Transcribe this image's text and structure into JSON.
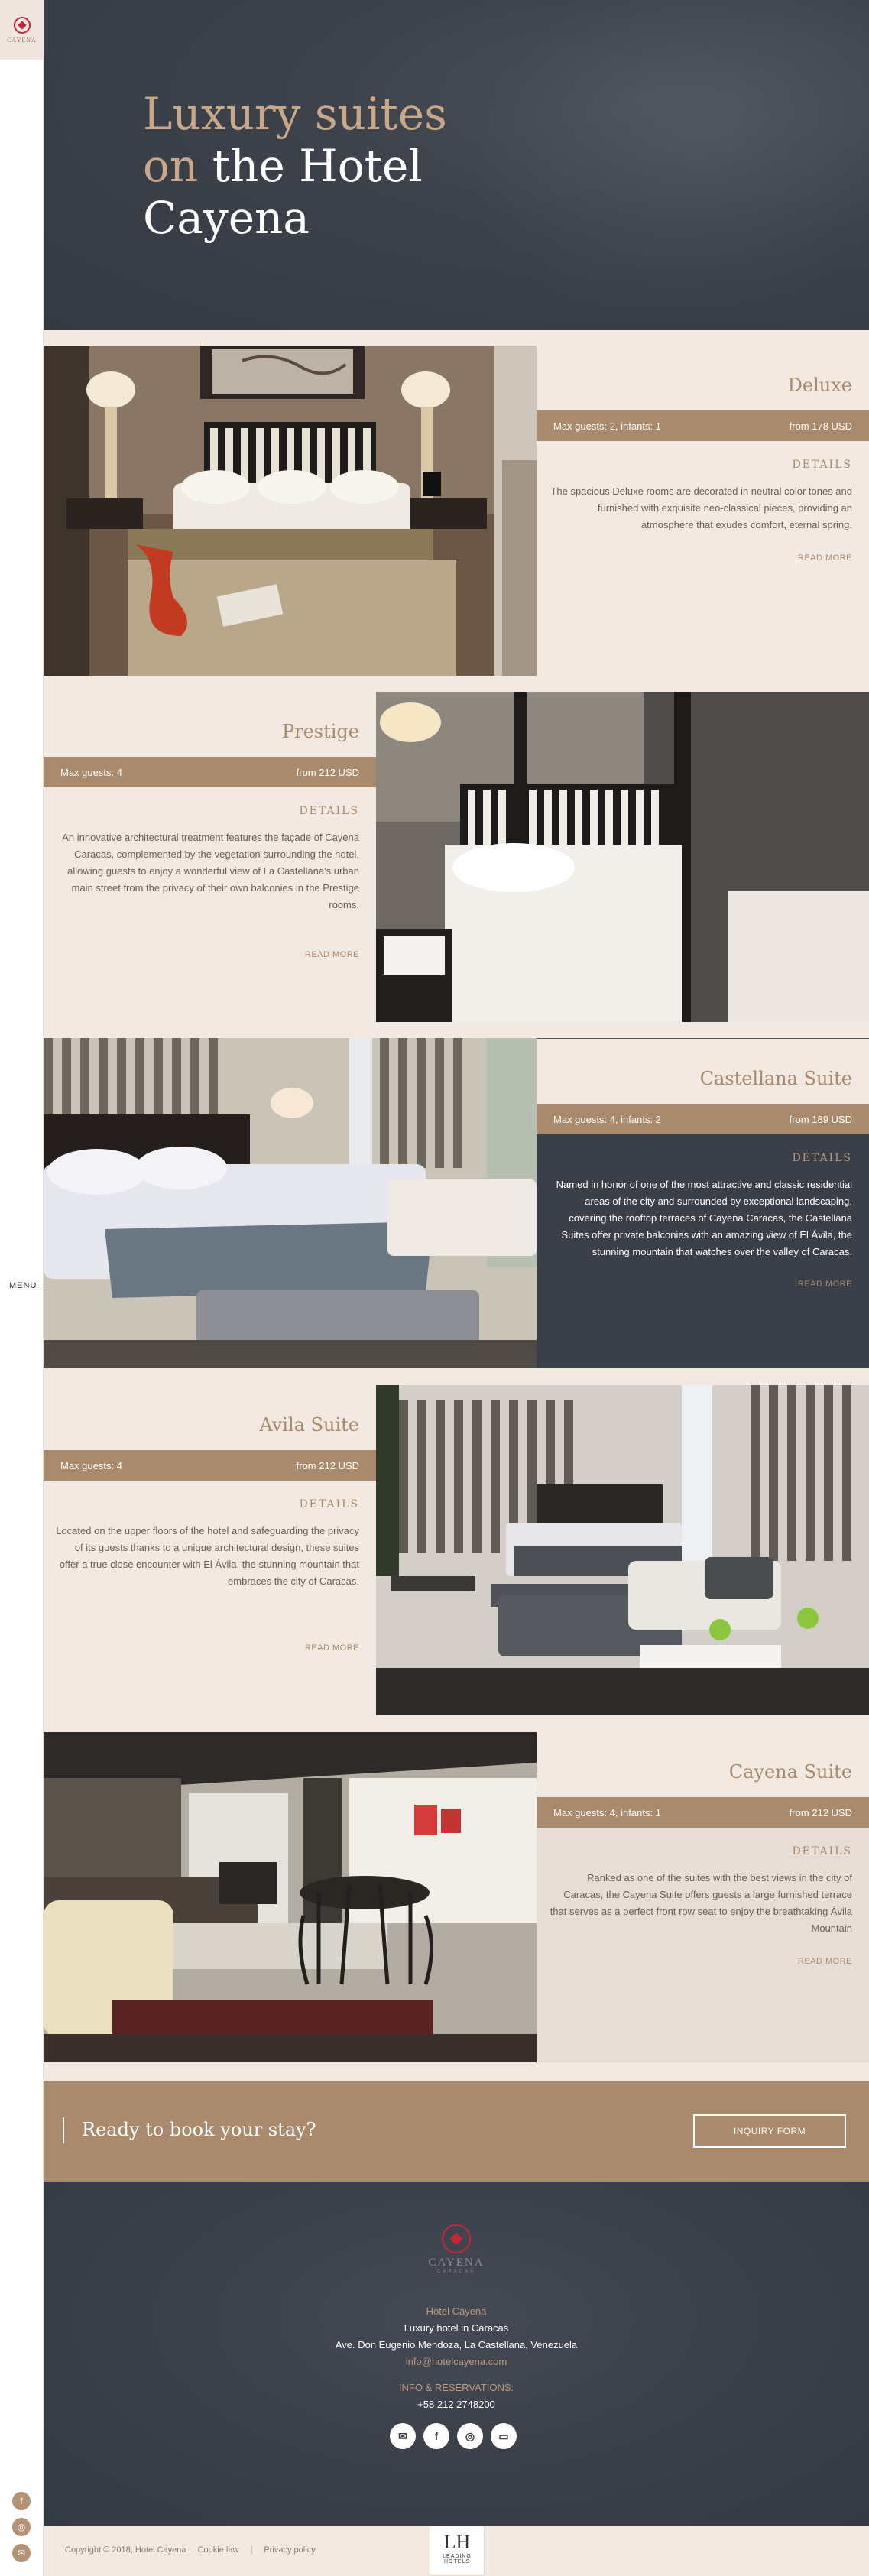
{
  "brand": {
    "rail_logo_text": "CAYENA",
    "footer_logo_name": "CAYENA",
    "footer_logo_sub": "CARACAS"
  },
  "rail": {
    "menu_label": "MENU",
    "social": [
      "f",
      "◎",
      "✉"
    ]
  },
  "hero": {
    "line1": "Luxury suites",
    "line2_accent": "on",
    "line2_rest": "the Hotel",
    "line3": "Cayena"
  },
  "suites": [
    {
      "title": "Deluxe",
      "guests": "Max guests: 2, infants: 1",
      "price": "from 178 USD",
      "details_label": "DETAILS",
      "description": "The spacious Deluxe rooms are decorated in neutral color tones and furnished with exquisite neo-classical pieces, providing an atmosphere that exudes comfort, eternal spring.",
      "more": "READ MORE"
    },
    {
      "title": "Prestige",
      "guests": "Max guests: 4",
      "price": "from 212 USD",
      "details_label": "DETAILS",
      "description": "An innovative architectural treatment features the façade of Cayena Caracas, complemented by the vegetation surrounding the hotel, allowing guests to enjoy a wonderful view of La Castellana's urban main street from the privacy of their own balconies in the Prestige rooms.",
      "more": "READ MORE"
    },
    {
      "title": "Castellana Suite",
      "guests": "Max guests: 4, infants: 2",
      "price": "from 189 USD",
      "details_label": "DETAILS",
      "description": "Named in honor of one of the most attractive and classic residential areas of the city and surrounded by exceptional landscaping, covering the rooftop terraces of Cayena Caracas, the Castellana Suites offer private balconies with an amazing view of El Ávila, the stunning mountain that watches over the valley of Caracas.",
      "more": "READ MORE"
    },
    {
      "title": "Avila Suite",
      "guests": "Max guests: 4",
      "price": "from 212 USD",
      "details_label": "DETAILS",
      "description": "Located on the upper floors of the hotel and safeguarding the privacy of its guests thanks to a unique architectural design, these suites offer a true close encounter with El Ávila, the stunning mountain that embraces the city of Caracas.",
      "more": "READ MORE"
    },
    {
      "title": "Cayena Suite",
      "guests": "Max guests: 4, infants: 1",
      "price": "from 212 USD",
      "details_label": "DETAILS",
      "description": "Ranked as one of the suites with the best views in the city of Caracas, the Cayena Suite offers guests a large furnished terrace that serves as a perfect front row seat to enjoy the breathtaking Ávila Mountain",
      "more": "READ MORE"
    }
  ],
  "cta": {
    "text": "Ready to book your stay?",
    "button": "INQUIRY FORM"
  },
  "footer": {
    "hotel_name": "Hotel Cayena",
    "tagline": "Luxury hotel in Caracas",
    "address": "Ave. Don Eugenio Mendoza, La Castellana, Venezuela",
    "email": "info@hotelcayena.com",
    "reservations_label": "INFO & RESERVATIONS:",
    "phone": "+58 212 2748200",
    "social": [
      "✉",
      "f",
      "◎",
      "▭"
    ]
  },
  "bottom": {
    "copyright": "Copyright © 2018, Hotel Cayena",
    "cookie": "Cookie law",
    "sep": "|",
    "privacy": "Privacy policy",
    "badge_glyph": "LH",
    "badge_text": "LEADING HOTELS"
  },
  "colors": {
    "gold": "#a98a6c",
    "dark": "#3b4048",
    "cream": "#f2e9e3",
    "brand_red": "#c3273a"
  }
}
